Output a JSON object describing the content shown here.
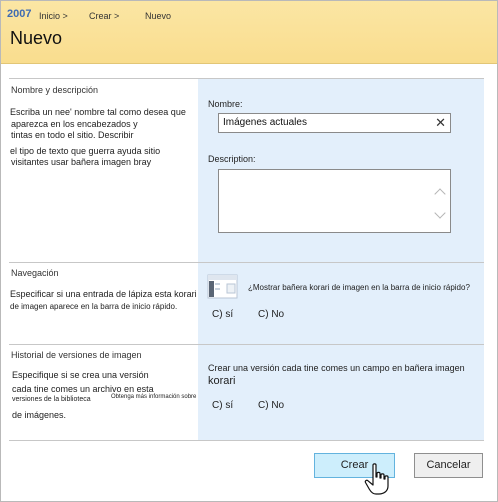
{
  "header": {
    "year": "2007",
    "breadcrumb": [
      "Inicio >",
      "Crear >",
      "Nuevo"
    ],
    "title": "Nuevo"
  },
  "name_section": {
    "title": "Nombre y descripción",
    "desc_line1": "Escriba un nee' nombre tal como desea que",
    "desc_line2": "aparezca en los encabezados y",
    "desc_line3": "tintas en todo el sitio. Describir",
    "desc_line4": "el tipo de texto que guerra ayuda sitio",
    "desc_line5": "visitantes usar bañera imagen bray",
    "name_label": "Nombre:",
    "name_value": "Imágenes actuales",
    "description_label": "Description:",
    "description_value": ""
  },
  "nav_section": {
    "title": "Navegación",
    "desc_line1": "Especificar si una entrada de lápiza esta korari",
    "desc_line2": "de imagen aparece en la barra de inicio rápido.",
    "question": "¿Mostrar bañera korari de imagen en la barra de inicio rápido?",
    "yes_label": "C) sí",
    "no_label": "C) No"
  },
  "version_section": {
    "title": "Historial de versiones de imagen",
    "desc_line1": "Especifique si se crea una versión",
    "desc_line2": "cada tine comes un archivo en esta",
    "desc_small1": "versiones de la biblioteca",
    "desc_small2": "Obtenga más información sobre",
    "desc_line3": "de imágenes.",
    "question_line1": "Crear una versión cada tine comes un campo en bañera imagen",
    "question_line2": "korari",
    "yes_label": "C) sí",
    "no_label": "C) No"
  },
  "buttons": {
    "create": "Crear",
    "cancel": "Cancelar"
  },
  "icons": [
    "clear-icon",
    "scroll-up-icon",
    "scroll-down-icon",
    "quick-launch-icon",
    "hand-cursor-icon"
  ],
  "colors": {
    "header_bg": "#f9dd8e",
    "panel_bg": "#e3effb",
    "create_bg": "#cdeefc",
    "accent": "#3f6cb2"
  }
}
